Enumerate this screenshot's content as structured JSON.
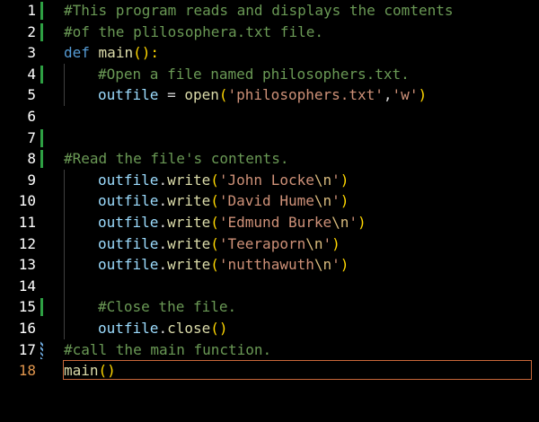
{
  "lines": [
    {
      "number": "1",
      "indent": 0,
      "marker": "mod",
      "tokens": [
        {
          "t": "c",
          "v": "#This program reads and displays the comtents"
        }
      ]
    },
    {
      "number": "2",
      "indent": 0,
      "marker": "mod",
      "tokens": [
        {
          "t": "c",
          "v": "#of the plilosophera.txt file."
        }
      ]
    },
    {
      "number": "3",
      "indent": 0,
      "marker": "none",
      "tokens": [
        {
          "t": "k",
          "v": "def"
        },
        {
          "t": "o",
          "v": " "
        },
        {
          "t": "f",
          "v": "main"
        },
        {
          "t": "p",
          "v": "():"
        }
      ]
    },
    {
      "number": "4",
      "indent": 1,
      "marker": "mod",
      "tokens": [
        {
          "t": "c",
          "v": "#Open a file named philosophers.txt."
        }
      ]
    },
    {
      "number": "5",
      "indent": 1,
      "marker": "none",
      "tokens": [
        {
          "t": "v",
          "v": "outfile"
        },
        {
          "t": "o",
          "v": " = "
        },
        {
          "t": "f",
          "v": "open"
        },
        {
          "t": "p",
          "v": "("
        },
        {
          "t": "s",
          "v": "'philosophers.txt'"
        },
        {
          "t": "o",
          "v": ","
        },
        {
          "t": "s",
          "v": "'w'"
        },
        {
          "t": "p",
          "v": ")"
        }
      ]
    },
    {
      "number": "6",
      "indent": 0,
      "marker": "none",
      "tokens": []
    },
    {
      "number": "7",
      "indent": 0,
      "marker": "mod",
      "tokens": []
    },
    {
      "number": "8",
      "indent": 0,
      "marker": "mod",
      "tokens": [
        {
          "t": "c",
          "v": "#Read the file's contents."
        }
      ]
    },
    {
      "number": "9",
      "indent": 1,
      "marker": "none",
      "tokens": [
        {
          "t": "v",
          "v": "outfile"
        },
        {
          "t": "o",
          "v": "."
        },
        {
          "t": "f",
          "v": "write"
        },
        {
          "t": "p",
          "v": "("
        },
        {
          "t": "s",
          "v": "'John Locke"
        },
        {
          "t": "e",
          "v": "\\n"
        },
        {
          "t": "s",
          "v": "'"
        },
        {
          "t": "p",
          "v": ")"
        }
      ]
    },
    {
      "number": "10",
      "indent": 1,
      "marker": "none",
      "tokens": [
        {
          "t": "v",
          "v": "outfile"
        },
        {
          "t": "o",
          "v": "."
        },
        {
          "t": "f",
          "v": "write"
        },
        {
          "t": "p",
          "v": "("
        },
        {
          "t": "s",
          "v": "'David Hume"
        },
        {
          "t": "e",
          "v": "\\n"
        },
        {
          "t": "s",
          "v": "'"
        },
        {
          "t": "p",
          "v": ")"
        }
      ]
    },
    {
      "number": "11",
      "indent": 1,
      "marker": "none",
      "tokens": [
        {
          "t": "v",
          "v": "outfile"
        },
        {
          "t": "o",
          "v": "."
        },
        {
          "t": "f",
          "v": "write"
        },
        {
          "t": "p",
          "v": "("
        },
        {
          "t": "s",
          "v": "'Edmund Burke"
        },
        {
          "t": "e",
          "v": "\\n"
        },
        {
          "t": "s",
          "v": "'"
        },
        {
          "t": "p",
          "v": ")"
        }
      ]
    },
    {
      "number": "12",
      "indent": 1,
      "marker": "none",
      "tokens": [
        {
          "t": "v",
          "v": "outfile"
        },
        {
          "t": "o",
          "v": "."
        },
        {
          "t": "f",
          "v": "write"
        },
        {
          "t": "p",
          "v": "("
        },
        {
          "t": "s",
          "v": "'Teeraporn"
        },
        {
          "t": "e",
          "v": "\\n"
        },
        {
          "t": "s",
          "v": "'"
        },
        {
          "t": "p",
          "v": ")"
        }
      ]
    },
    {
      "number": "13",
      "indent": 1,
      "marker": "none",
      "tokens": [
        {
          "t": "v",
          "v": "outfile"
        },
        {
          "t": "o",
          "v": "."
        },
        {
          "t": "f",
          "v": "write"
        },
        {
          "t": "p",
          "v": "("
        },
        {
          "t": "s",
          "v": "'nutthawuth"
        },
        {
          "t": "e",
          "v": "\\n"
        },
        {
          "t": "s",
          "v": "'"
        },
        {
          "t": "p",
          "v": ")"
        }
      ]
    },
    {
      "number": "14",
      "indent": 0,
      "marker": "none",
      "tokens": []
    },
    {
      "number": "15",
      "indent": 1,
      "marker": "mod",
      "tokens": [
        {
          "t": "c",
          "v": "#Close the file."
        }
      ]
    },
    {
      "number": "16",
      "indent": 1,
      "marker": "none",
      "tokens": [
        {
          "t": "v",
          "v": "outfile"
        },
        {
          "t": "o",
          "v": "."
        },
        {
          "t": "f",
          "v": "close"
        },
        {
          "t": "p",
          "v": "()"
        }
      ]
    },
    {
      "number": "17",
      "indent": 0,
      "marker": "hatch",
      "tokens": [
        {
          "t": "c",
          "v": "#call the main function."
        }
      ]
    },
    {
      "number": "18",
      "indent": 0,
      "marker": "none",
      "current": true,
      "tokens": [
        {
          "t": "f",
          "v": "main"
        },
        {
          "t": "p",
          "v": "()"
        }
      ]
    }
  ]
}
